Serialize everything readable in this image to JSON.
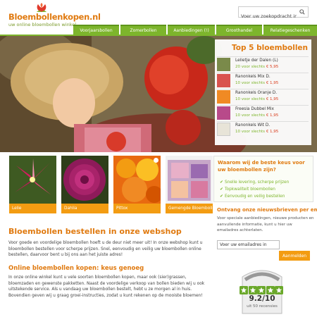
{
  "header": {
    "logo_text": "Bloembollenkopen.nl",
    "tagline": "uw online bloembollen winkel",
    "search_placeholder": "Voer uw zoekopdracht in"
  },
  "nav": [
    {
      "label": "Voorjaarsbollen"
    },
    {
      "label": "Zomerbollen"
    },
    {
      "label": "Aanbiedingen (!)"
    },
    {
      "label": "Groothandel"
    },
    {
      "label": "Relatiegeschenken"
    }
  ],
  "top5": {
    "title": "Top 5 bloembollen",
    "items": [
      {
        "name": "Lelietje der Dalen (L)",
        "price_prefix": "20 voor slechts",
        "price": "€ 5,95",
        "color": "#7a8a4a"
      },
      {
        "name": "Ranonkels Mix D.",
        "price_prefix": "10 voor slechts",
        "price": "€ 1,95",
        "color": "#d9534f"
      },
      {
        "name": "Ranonkels Oranje D.",
        "price_prefix": "10 voor slechts",
        "price": "€ 1,95",
        "color": "#f08a24"
      },
      {
        "name": "Freesia Dubbel Mix",
        "price_prefix": "10 voor slechts",
        "price": "€ 1,95",
        "color": "#b84a8a"
      },
      {
        "name": "Ranonkels Wit D.",
        "price_prefix": "10 voor slechts",
        "price": "€ 1,95",
        "color": "#e8e4d8"
      }
    ]
  },
  "categories": [
    {
      "label": "Lelie",
      "color": "#c2185b"
    },
    {
      "label": "Dahlia",
      "color": "#8e1a5a"
    },
    {
      "label": "Pittox",
      "color": "#ef7d10"
    },
    {
      "label": "Gemengde Bloembollen",
      "color": "#c7a6c8"
    }
  ],
  "why": {
    "title": "Waarom wij de beste keus voor uw bloembollen zijn?",
    "items": [
      "Snelle levering, scherpe prijzen",
      "Topkwaliteit bloembollen",
      "Eenvoudig en veilig bestellen"
    ]
  },
  "newsletter": {
    "title": "Ontvang onze nieuwsbrieven per email",
    "text": "Voor speciale aanbiedingen, nieuwe producten en aanvullende informatie, kunt u hier uw emailadres achterlaten.",
    "input_placeholder": "Voer uw emailadres in",
    "button_label": "Aanmelden"
  },
  "main": {
    "title": "Bloembollen bestellen in onze webshop",
    "intro": "Voor goede en voordelige bloembollen hoeft u de deur niet meer uit! In onze webshop kunt u bloembollen bestellen voor scherpe prijzen. Snel, eenvoudig en veilig uw bloembollen online bestellen, daarvoor bent u bij ons aan het juiste adres!",
    "subtitle": "Online bloembollen kopen: keus genoeg",
    "body": "In onze online winkel kunt u vele soorten bloembollen kopen, maar ook (sier)grassen, bloemzaden en gewenste pakketten. Naast de voordelige verkoop van bollen bieden wij u ook uitstekende service. Als u vandaag uw bloembollen bestelt, hebt u ze morgen al in huis. Bovendien geven wij u graag groei-instructies, zodat u kunt rekenen op de mooiste bloemen!"
  },
  "rating": {
    "score": "9.2/10",
    "reviews": "uit 50 recensies",
    "stars": 5
  },
  "colors": {
    "accent_orange": "#e07a10",
    "nav_green": "#7db52c",
    "tile_orange": "#f39c12"
  }
}
